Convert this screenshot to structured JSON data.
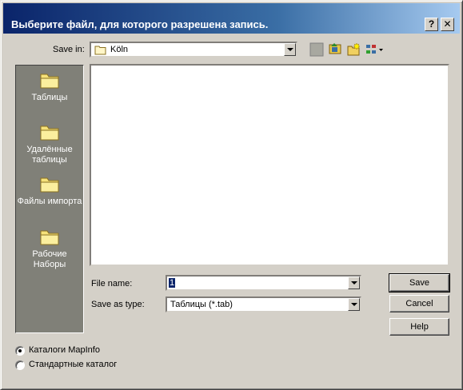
{
  "window": {
    "title": "Выберите файл, для которого разрешена запись.",
    "help_glyph": "?",
    "close_glyph": "✕"
  },
  "save_in": {
    "label": "Save in:",
    "value": "Köln"
  },
  "toolbar": {
    "icons": [
      "up-folder-icon",
      "desktop-icon",
      "new-folder-icon",
      "view-menu-icon"
    ]
  },
  "places": [
    {
      "label": "Таблицы",
      "icon": "folder-icon"
    },
    {
      "label": "Удалённые таблицы",
      "icon": "folder-icon"
    },
    {
      "label": "Файлы импорта",
      "icon": "folder-icon"
    },
    {
      "label": "Рабочие Наборы",
      "icon": "folder-icon"
    }
  ],
  "file_name": {
    "label": "File name:",
    "value": "1"
  },
  "save_as_type": {
    "label": "Save as type:",
    "value": "Таблицы (*.tab)"
  },
  "buttons": {
    "save": "Save",
    "cancel": "Cancel",
    "help": "Help"
  },
  "catalog_options": [
    {
      "label": "Каталоги MapInfo",
      "checked": true
    },
    {
      "label": "Стандартные каталог",
      "checked": false
    }
  ],
  "colors": {
    "title_start": "#0a246a",
    "title_end": "#a6caf0",
    "face": "#d4d0c8",
    "places_bg": "#808078"
  }
}
